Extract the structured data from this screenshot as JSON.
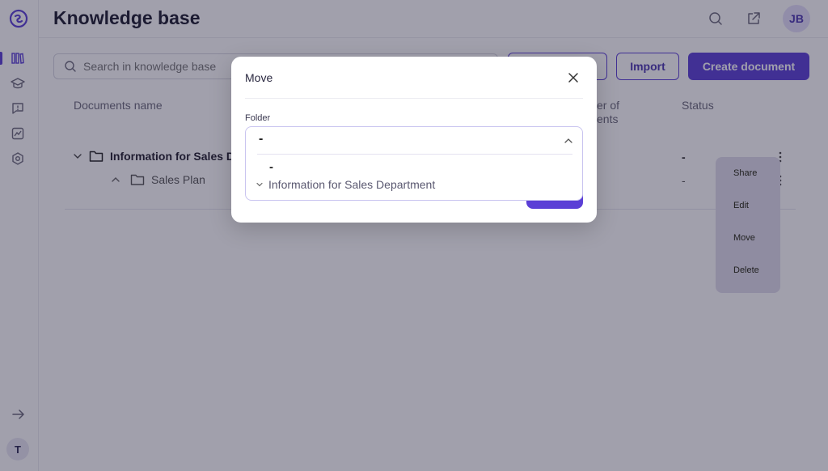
{
  "header": {
    "title": "Knowledge base",
    "user_initials": "JB"
  },
  "sidebar": {
    "user_initial": "T"
  },
  "toolbar": {
    "search_placeholder": "Search in knowledge base",
    "import_label": "Import",
    "create_label": "Create document"
  },
  "table": {
    "columns": [
      "Documents name",
      "er of",
      "ents",
      "Status"
    ],
    "rows": [
      {
        "name": "Information for Sales D",
        "status": "-"
      },
      {
        "name": "Sales Plan",
        "status": "-"
      }
    ]
  },
  "context_menu": {
    "items": [
      "Share",
      "Edit",
      "Move",
      "Delete"
    ]
  },
  "modal": {
    "title": "Move",
    "folder_label": "Folder",
    "selected_value": "-",
    "options": [
      "-",
      "Information for Sales Department"
    ]
  },
  "colors": {
    "accent": "#5b3fd6",
    "overlay": "#201c3a"
  }
}
